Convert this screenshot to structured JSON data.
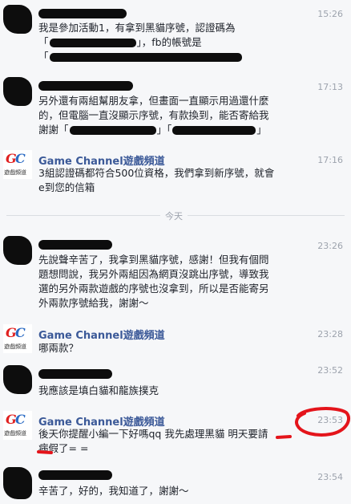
{
  "divider": {
    "label": "今天"
  },
  "brand": {
    "name": "Game Channel遊戲頻道",
    "logo_caption": "遊戲頻道",
    "logo_g": "G",
    "logo_c": "C"
  },
  "messages": [
    {
      "time": "15:26",
      "lines": [
        "我是參加活動1，有拿到黑貓序號，認證碼為",
        "「",
        "」，fb的帳號是",
        "「",
        ""
      ]
    },
    {
      "time": "17:13",
      "lines": [
        "另外還有兩組幫朋友拿，但畫面一直顯示用過還什麼",
        "的，但電腦一直沒顯示序號，有款換到，能否寄給我",
        "謝謝「",
        "」「",
        "」"
      ]
    },
    {
      "time": "17:16",
      "lines": [
        "3組認證碼都符合500位資格，我們拿到新序號，就會",
        "e到您的信箱"
      ]
    },
    {
      "time": "23:26",
      "lines": [
        "先說聲辛苦了，我拿到黑貓序號，感謝！但我有個問",
        "題想問說，我另外兩組因為網頁沒跳出序號，導致我",
        "選的另外兩款遊戲的序號也沒拿到，所以是否能寄另",
        "外兩款序號給我，謝謝～"
      ]
    },
    {
      "time": "23:28",
      "lines": [
        "哪兩款？"
      ]
    },
    {
      "time": "23:52",
      "lines": [
        "我應該是填白貓和龍族撲克"
      ]
    },
    {
      "time": "23:53",
      "lines": [
        "後天你提醒小編一下好嗎qq 我先處理黑貓 明天要請",
        "病假了= ="
      ]
    },
    {
      "time": "23:54",
      "lines": [
        "辛苦了，好的，我知道了，謝謝～"
      ]
    }
  ]
}
